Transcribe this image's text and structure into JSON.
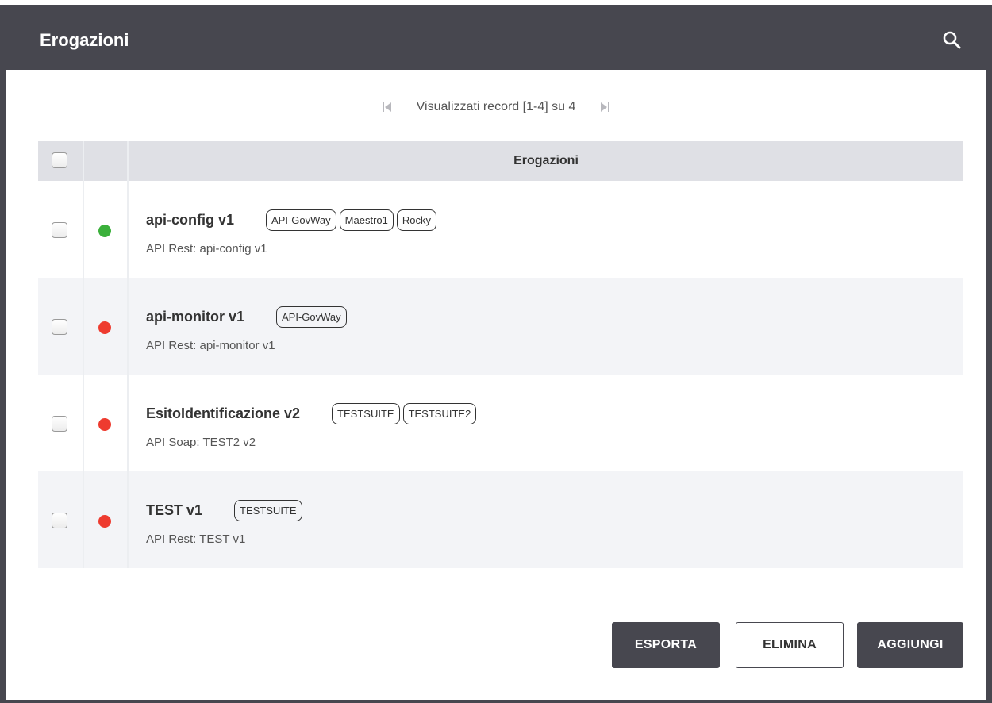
{
  "header": {
    "title": "Erogazioni",
    "search_icon": "search-icon"
  },
  "pager": {
    "text": "Visualizzati record [1-4] su 4",
    "first_icon": "first-page-icon",
    "last_icon": "last-page-icon"
  },
  "table": {
    "column_header": "Erogazioni",
    "rows": [
      {
        "name": "api-config v1",
        "status": "green",
        "tags": [
          "API-GovWay",
          "Maestro1",
          "Rocky"
        ],
        "subtitle": "API Rest: api-config v1"
      },
      {
        "name": "api-monitor v1",
        "status": "red",
        "tags": [
          "API-GovWay"
        ],
        "subtitle": "API Rest: api-monitor v1"
      },
      {
        "name": "EsitoIdentificazione v2",
        "status": "red",
        "tags": [
          "TESTSUITE",
          "TESTSUITE2"
        ],
        "subtitle": "API Soap: TEST2 v2"
      },
      {
        "name": "TEST v1",
        "status": "red",
        "tags": [
          "TESTSUITE"
        ],
        "subtitle": "API Rest: TEST v1"
      }
    ]
  },
  "status_colors": {
    "green": "#3bb03b",
    "red": "#ee3b2f"
  },
  "buttons": {
    "export": "ESPORTA",
    "delete": "ELIMINA",
    "add": "AGGIUNGI"
  }
}
